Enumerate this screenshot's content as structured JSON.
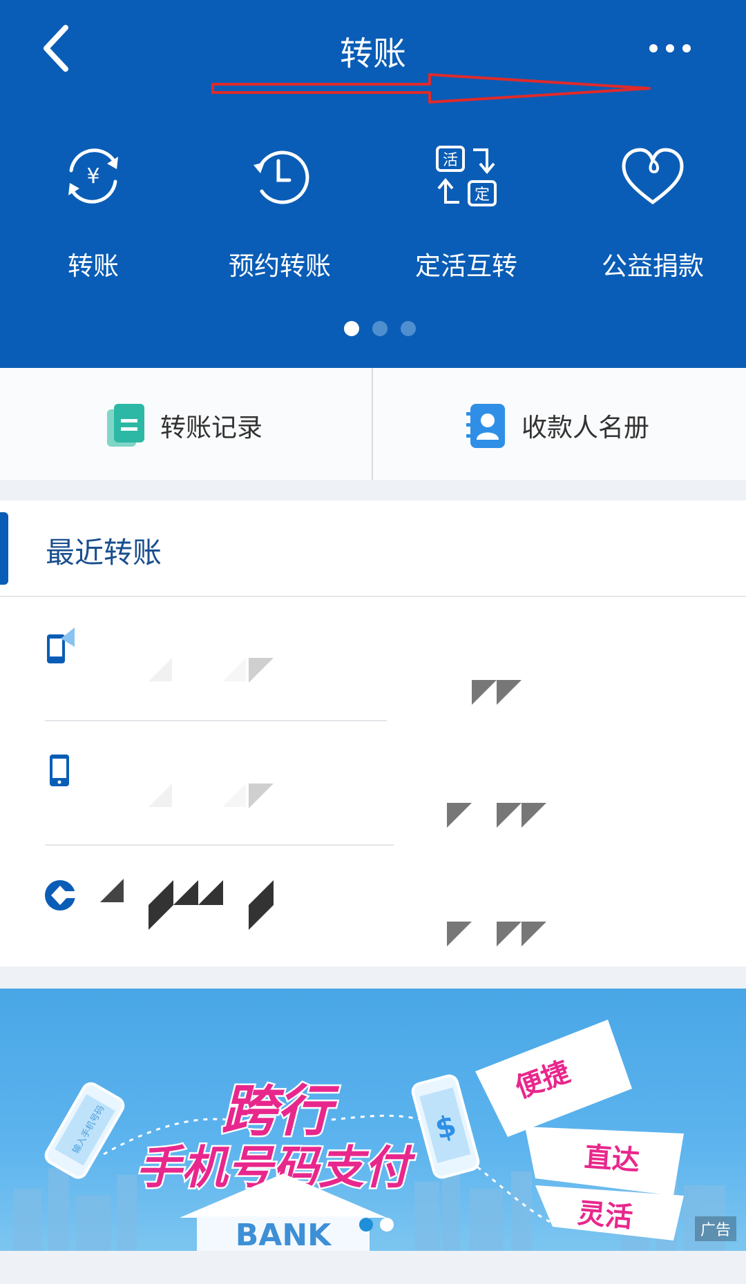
{
  "header": {
    "title": "转账",
    "back_icon": "back-arrow-icon",
    "more_icon": "more-dots-icon"
  },
  "quick_actions": [
    {
      "label": "转账",
      "icon": "yen-exchange-icon"
    },
    {
      "label": "预约转账",
      "icon": "clock-icon"
    },
    {
      "label": "定活互转",
      "icon": "deposit-swap-icon"
    },
    {
      "label": "公益捐款",
      "icon": "heart-icon"
    }
  ],
  "carousel": {
    "active_page": 1,
    "page_count": 3
  },
  "shortcuts": {
    "records": {
      "label": "转账记录",
      "icon": "document-icon"
    },
    "payees": {
      "label": "收款人名册",
      "icon": "contacts-book-icon"
    }
  },
  "recent": {
    "title": "最近转账",
    "items": [
      {
        "icon": "phone-icon"
      },
      {
        "icon": "phone-icon"
      },
      {
        "icon": "ccb-bank-logo-icon"
      }
    ]
  },
  "ad": {
    "headline_1": "跨行",
    "headline_2": "手机号码支付",
    "phone_text": "输入手机号码",
    "bank_text": "BANK",
    "tags": [
      "便捷",
      "直达",
      "灵活"
    ],
    "ad_label": "广告",
    "carousel": {
      "active_page": 1,
      "page_count": 2
    }
  },
  "colors": {
    "header_blue": "#0a5db6",
    "annotation_red": "#e02a2a",
    "ad_pink": "#e8278c"
  }
}
